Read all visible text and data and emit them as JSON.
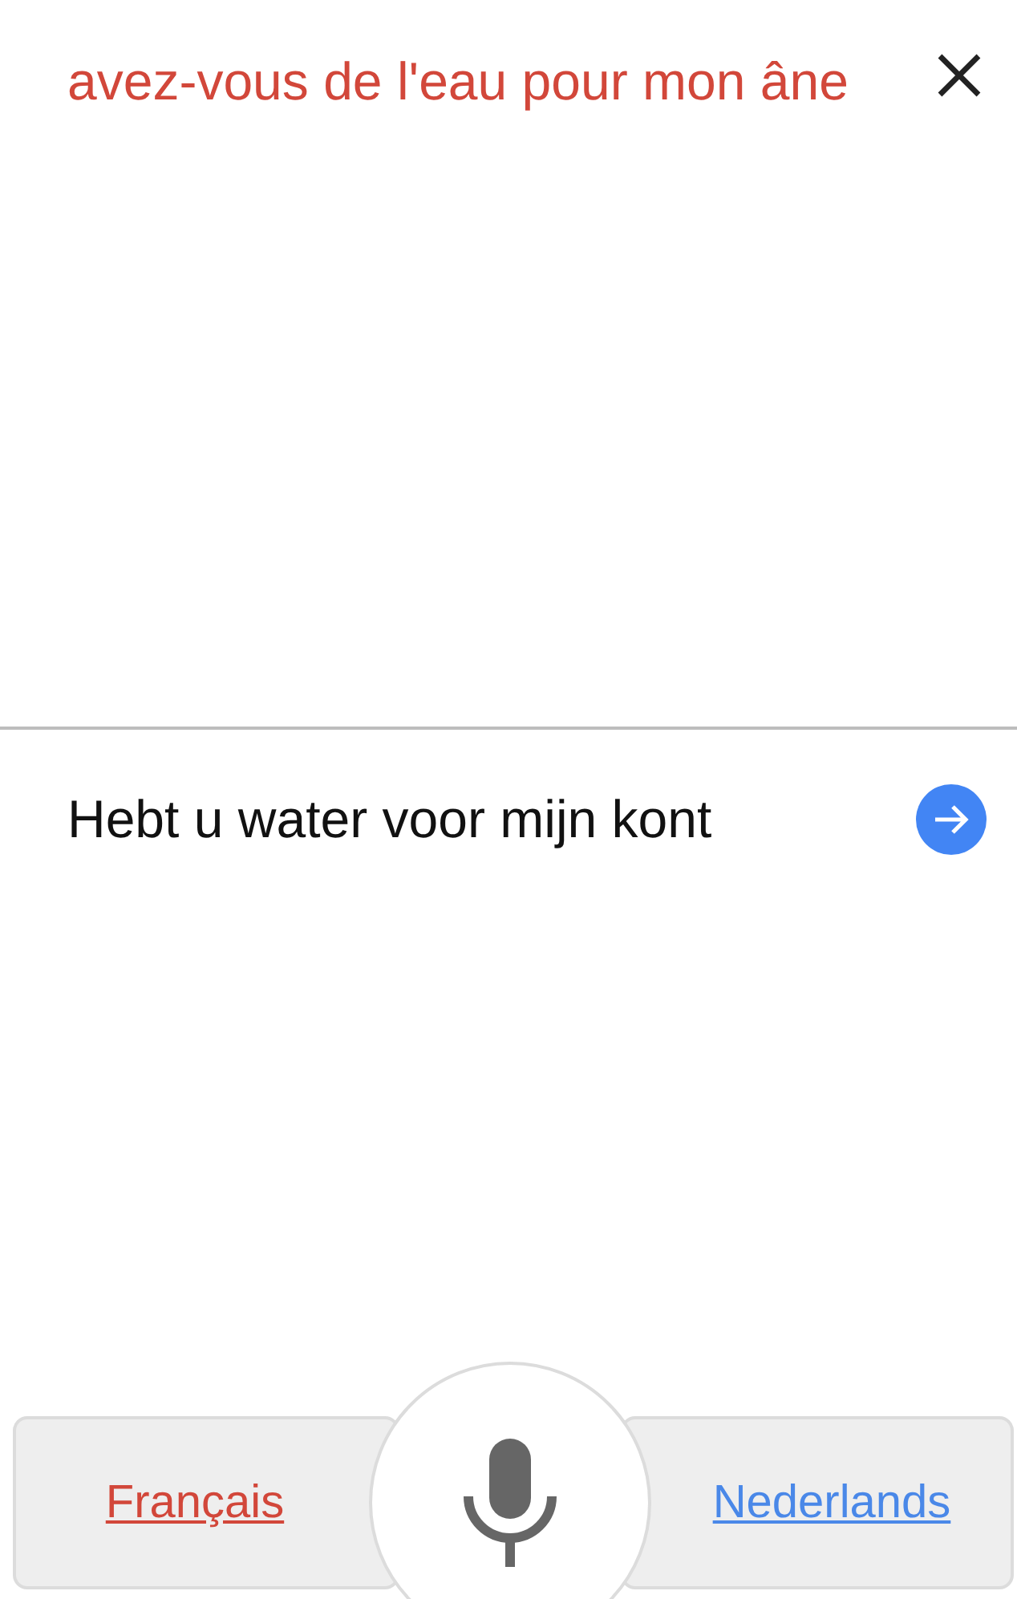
{
  "source": {
    "text": "avez-vous de l'eau pour mon âne"
  },
  "translation": {
    "text": "Hebt u water voor mijn kont"
  },
  "languages": [
    {
      "label": "Français",
      "color": "#d2473a"
    },
    {
      "label": "Nederlands",
      "color": "#4a88e8"
    }
  ]
}
